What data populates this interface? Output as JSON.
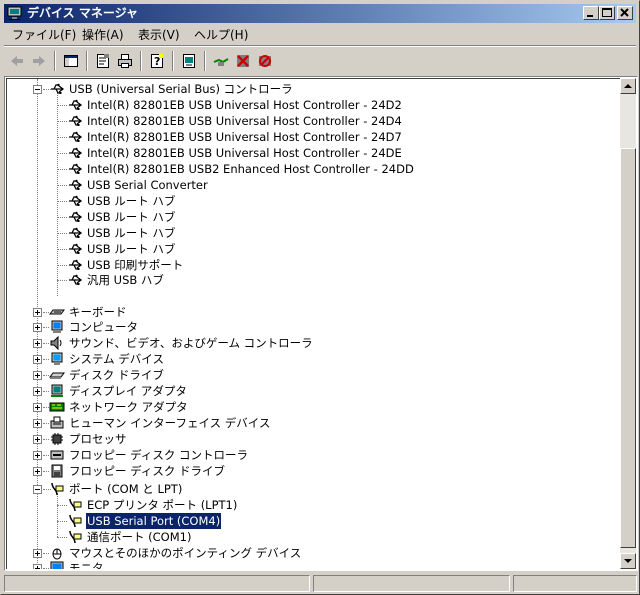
{
  "window": {
    "title": "デバイス マネージャ"
  },
  "title_buttons": {
    "minimize": "_",
    "maximize": "□",
    "close": "×"
  },
  "menu": [
    {
      "label": "ファイル(F)"
    },
    {
      "label": "操作(A)"
    },
    {
      "label": "表示(V)"
    },
    {
      "label": "ヘルプ(H)"
    }
  ],
  "toolbar": {
    "icons": [
      "back-arrow-icon",
      "forward-arrow-icon",
      "show-hide-console-tree-icon",
      "properties-icon",
      "print-icon",
      "help-icon",
      "scan-hardware-icon",
      "update-driver-icon",
      "uninstall-icon",
      "disable-icon"
    ]
  },
  "tree": {
    "usb_category": "USB (Universal Serial Bus) コントローラ",
    "usb_children": [
      "Intel(R) 82801EB USB Universal Host Controller - 24D2",
      "Intel(R) 82801EB USB Universal Host Controller - 24D4",
      "Intel(R) 82801EB USB Universal Host Controller - 24D7",
      "Intel(R) 82801EB USB Universal Host Controller - 24DE",
      "Intel(R) 82801EB USB2 Enhanced Host Controller - 24DD",
      "USB Serial Converter",
      "USB ルート ハブ",
      "USB ルート ハブ",
      "USB ルート ハブ",
      "USB ルート ハブ",
      "USB 印刷サポート",
      "汎用 USB ハブ"
    ],
    "categories_mid": [
      {
        "label": "キーボード",
        "icon": "keyboard-icon"
      },
      {
        "label": "コンピュータ",
        "icon": "computer-icon"
      },
      {
        "label": "サウンド、ビデオ、およびゲーム コントローラ",
        "icon": "speaker-icon"
      },
      {
        "label": "システム デバイス",
        "icon": "system-device-icon"
      },
      {
        "label": "ディスク ドライブ",
        "icon": "disk-drive-icon"
      },
      {
        "label": "ディスプレイ アダプタ",
        "icon": "display-adapter-icon"
      },
      {
        "label": "ネットワーク アダプタ",
        "icon": "network-adapter-icon"
      },
      {
        "label": "ヒューマン インターフェイス デバイス",
        "icon": "hid-icon"
      },
      {
        "label": "プロセッサ",
        "icon": "processor-icon"
      },
      {
        "label": "フロッピー ディスク コントローラ",
        "icon": "floppy-controller-icon"
      },
      {
        "label": "フロッピー ディスク ドライブ",
        "icon": "floppy-drive-icon"
      }
    ],
    "ports_category": "ポート (COM と LPT)",
    "ports_children": [
      {
        "label": "ECP プリンタ ポート (LPT1)",
        "selected": false
      },
      {
        "label": "USB Serial Port (COM4)",
        "selected": true
      },
      {
        "label": "通信ポート (COM1)",
        "selected": false
      }
    ],
    "categories_bottom": [
      {
        "label": "マウスとそのほかのポインティング デバイス",
        "icon": "mouse-icon"
      },
      {
        "label": "モニタ",
        "icon": "monitor-icon"
      }
    ]
  },
  "colors": {
    "titlebar_start": "#0a246a",
    "titlebar_end": "#a6caf0",
    "selection": "#0a246a",
    "face": "#d4d0c8"
  }
}
